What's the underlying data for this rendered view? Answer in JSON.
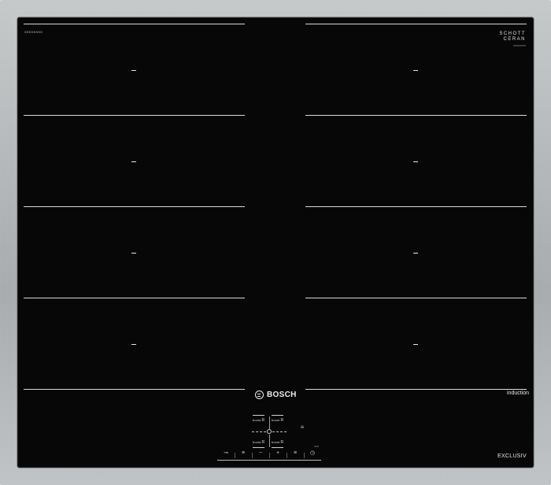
{
  "hob": {
    "model_code": "XXXXXXXX",
    "glass_brand": {
      "line1": "SCHOTT",
      "line2": "CERAN",
      "line3": "XXXXXXXX"
    },
    "brand": "BOSCH",
    "induction_label": "induction",
    "series_label": "EXCLUSIV"
  },
  "controls": {
    "boost_labels": [
      "boost",
      "boost",
      "boost",
      "boost"
    ],
    "boost_icon": "R",
    "keys": [
      {
        "name": "key-lock",
        "icon": "key-icon",
        "glyph": "⊸"
      },
      {
        "name": "zone-menu",
        "icon": "menu-icon",
        "glyph": "≡"
      },
      {
        "name": "minus",
        "icon": "minus-icon",
        "glyph": "−"
      },
      {
        "name": "plus",
        "icon": "plus-icon",
        "glyph": "+"
      },
      {
        "name": "zone-menu-2",
        "icon": "menu-icon",
        "glyph": "≡"
      },
      {
        "name": "timer",
        "icon": "clock-icon",
        "glyph": "◷"
      }
    ],
    "bell_icon": "bell-icon",
    "small_label": "XXX"
  }
}
